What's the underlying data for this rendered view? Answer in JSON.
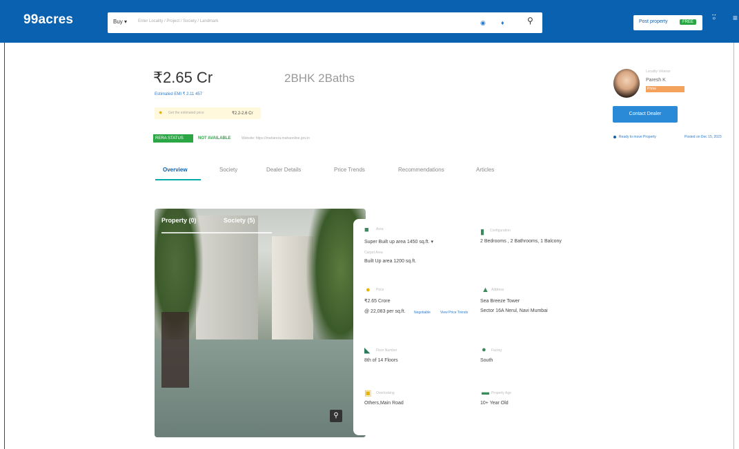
{
  "header": {
    "logo": "99acres",
    "buy_label": "Buy ▾",
    "search_placeholder": "Enter Locality / Project / Society / Landmark",
    "post_property_label": "Post property",
    "free_badge": "FREE"
  },
  "listing": {
    "price": "₹2.65 Cr",
    "config": "2BHK 2Baths",
    "emi": "Estimated EMI ₹ 2.11 457",
    "estimate_label": "Get the estimated price",
    "estimate_value": "₹2.2-2.6 Cr",
    "rera_label": "RERA STATUS",
    "rera_status": "NOT AVAILABLE",
    "rera_note": "Website: https://maharera.mahaonline.gov.in"
  },
  "tabs": [
    {
      "label": "Overview",
      "active": true
    },
    {
      "label": "Society",
      "active": false
    },
    {
      "label": "Dealer Details",
      "active": false
    },
    {
      "label": "Price Trends",
      "active": false
    },
    {
      "label": "Recommendations",
      "active": false
    },
    {
      "label": "Articles",
      "active": false
    }
  ],
  "agent": {
    "type": "Locality Veteran",
    "name": "Paresh K",
    "badge": "Prime",
    "contact_label": "Contact Dealer",
    "ready_to_move": "Ready to move Property",
    "posted_on": "Posted on Dec 15, 2023"
  },
  "gallery": {
    "tab_property": "Property (0)",
    "tab_society": "Society (5)"
  },
  "details": {
    "area_label": "Area",
    "super_area": "Super Built up area 1450 sq.ft. ▾",
    "carpet_label": "Carpet Area",
    "built_area": "Built Up area 1200 sq.ft.",
    "config_label": "Configuration",
    "config_value": "2 Bedrooms , 2 Bathrooms, 1 Balcony",
    "price_label": "Price",
    "price_value": "₹2.65 Crore",
    "price_per_sqft": "@ 22,083 per sq.ft.",
    "price_negotiable": "Negotiable",
    "price_trends_link": "View Price Trends",
    "address_label": "Address",
    "address_line1": "Sea Breeze Tower",
    "address_line2": "Sector 16A Nerul, Navi Mumbai",
    "floor_label": "Floor Number",
    "floor_value": "8th of 14 Floors",
    "facing_label": "Facing",
    "facing_value": "South",
    "overlooking_label": "Overlooking",
    "overlooking_value": "Others,Main Road",
    "age_label": "Property Age",
    "age_value": "10+ Year Old"
  },
  "icons": {
    "search": "search-icon",
    "voice": "mic-icon",
    "location": "location-icon",
    "user": "user-icon",
    "zoom": "zoom-icon"
  },
  "colors": {
    "brand": "#0a61b0",
    "accent": "#2aa744"
  }
}
